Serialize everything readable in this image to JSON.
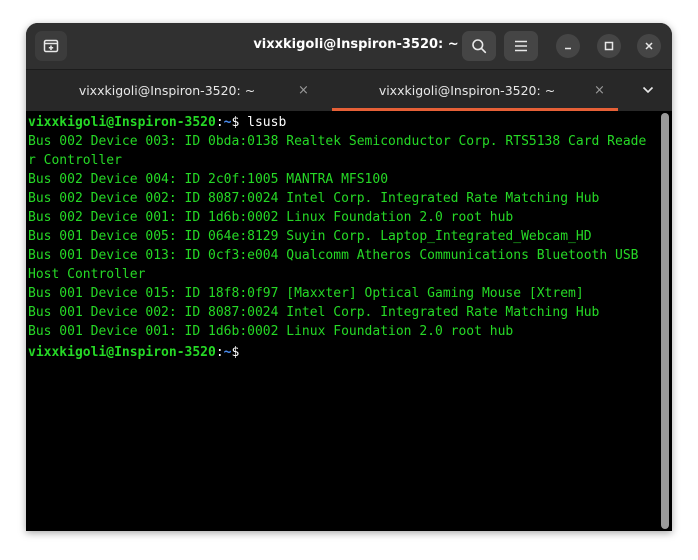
{
  "window": {
    "title": "vixxkigoli@Inspiron-3520: ~"
  },
  "headerbar": {
    "icons": [
      "new-tab-icon",
      "search-icon",
      "hamburger-menu-icon",
      "minimize-icon",
      "maximize-icon",
      "close-icon"
    ]
  },
  "tabs": [
    {
      "label": "vixxkigoli@Inspiron-3520: ~",
      "close": "×",
      "active": false
    },
    {
      "label": "vixxkigoli@Inspiron-3520: ~",
      "close": "×",
      "active": true
    }
  ],
  "colors": {
    "accent": "#e66037",
    "terminal_fg": "#26d926",
    "prompt_path": "#4a8cf0",
    "headerbar_bg": "#303030",
    "terminal_bg": "#000000"
  },
  "terminal": {
    "prompt1": {
      "user": "vixxkigoli@Inspiron-3520",
      "sep": ":",
      "path": "~",
      "sym": "$ ",
      "command": "lsusb"
    },
    "output": [
      "Bus 002 Device 003: ID 0bda:0138 Realtek Semiconductor Corp. RTS5138 Card Reade",
      "r Controller",
      "Bus 002 Device 004: ID 2c0f:1005 MANTRA MFS100",
      "Bus 002 Device 002: ID 8087:0024 Intel Corp. Integrated Rate Matching Hub",
      "Bus 002 Device 001: ID 1d6b:0002 Linux Foundation 2.0 root hub",
      "Bus 001 Device 005: ID 064e:8129 Suyin Corp. Laptop_Integrated_Webcam_HD",
      "Bus 001 Device 013: ID 0cf3:e004 Qualcomm Atheros Communications Bluetooth USB",
      "Host Controller",
      "Bus 001 Device 015: ID 18f8:0f97 [Maxxter] Optical Gaming Mouse [Xtrem]",
      "Bus 001 Device 002: ID 8087:0024 Intel Corp. Integrated Rate Matching Hub",
      "Bus 001 Device 001: ID 1d6b:0002 Linux Foundation 2.0 root hub"
    ],
    "prompt2": {
      "user": "vixxkigoli@Inspiron-3520",
      "sep": ":",
      "path": "~",
      "sym": "$ "
    }
  }
}
